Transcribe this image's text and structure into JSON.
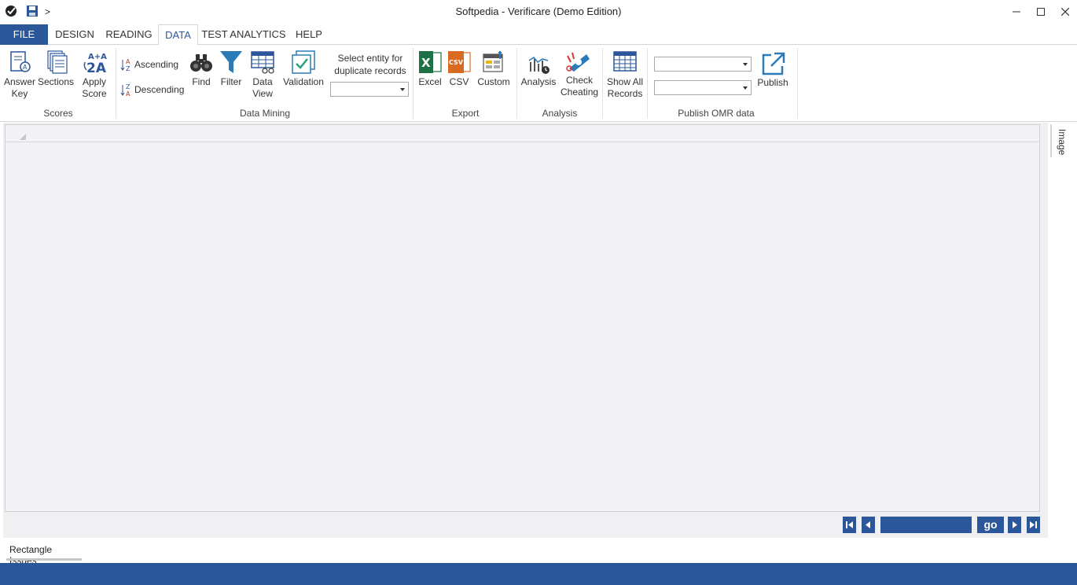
{
  "window": {
    "title": "Softpedia - Verificare (Demo Edition)",
    "qa_more": ">"
  },
  "tabs": {
    "file": "FILE",
    "design": "DESIGN",
    "reading": "READING",
    "data": "DATA",
    "test_analytics": "TEST ANALYTICS",
    "help": "HELP"
  },
  "ribbon": {
    "scores": {
      "group": "Scores",
      "answer_key": "Answer Key",
      "sections": "Sections",
      "apply_score": "Apply Score"
    },
    "data_mining": {
      "group": "Data Mining",
      "ascending": "Ascending",
      "descending": "Descending",
      "find": "Find",
      "filter": "Filter",
      "data_view": "Data View",
      "validation": "Validation",
      "select_entity_label": "Select entity for duplicate records",
      "select_entity_value": ""
    },
    "export": {
      "group": "Export",
      "excel": "Excel",
      "csv": "CSV",
      "custom": "Custom"
    },
    "analysis": {
      "group": "Analysis",
      "analysis": "Analysis",
      "check_cheating": "Check Cheating"
    },
    "records": {
      "show_all": "Show All Records"
    },
    "publish": {
      "group": "Publish OMR data",
      "combo1": "",
      "combo2": "",
      "publish": "Publish"
    }
  },
  "pager": {
    "go": "go",
    "page_value": ""
  },
  "side_panel": {
    "image_tab": "Image"
  },
  "bottom_tabs": {
    "rectangle_issues": "Rectangle Issues"
  },
  "colors": {
    "accent": "#2b579a",
    "excel_green": "#1e7145",
    "csv_orange": "#d86a21",
    "icon_blue": "#2b7bb9"
  }
}
